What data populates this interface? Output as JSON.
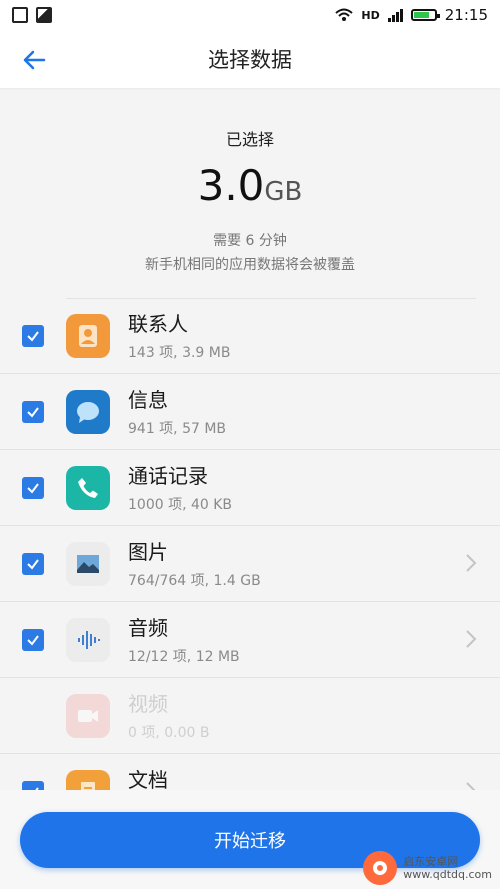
{
  "status_bar": {
    "time": "21:15",
    "network": "HD",
    "icons": [
      "notification-icon",
      "image-icon",
      "wifi-icon",
      "hd-icon",
      "signal-icon",
      "battery-icon"
    ]
  },
  "header": {
    "title": "选择数据",
    "back_icon": "arrow-left-icon"
  },
  "summary": {
    "label": "已选择",
    "size_value": "3.0",
    "size_unit": "GB",
    "time_text": "需要 6 分钟",
    "note": "新手机相同的应用数据将会被覆盖"
  },
  "items": [
    {
      "name": "联系人",
      "meta": "143 项, 3.9 MB",
      "checked": true,
      "icon": "contacts-icon",
      "color": "#f29a3b",
      "chevron": false
    },
    {
      "name": "信息",
      "meta": "941 项, 57 MB",
      "checked": true,
      "icon": "message-icon",
      "color": "#1f7ac9",
      "chevron": false
    },
    {
      "name": "通话记录",
      "meta": "1000 项, 40 KB",
      "checked": true,
      "icon": "phone-icon",
      "color": "#1bb6a5",
      "chevron": false
    },
    {
      "name": "图片",
      "meta": "764/764 项, 1.4 GB",
      "checked": true,
      "icon": "photo-icon",
      "color": "#ececec",
      "chevron": true
    },
    {
      "name": "音频",
      "meta": "12/12 项, 12 MB",
      "checked": true,
      "icon": "audio-icon",
      "color": "#ececec",
      "chevron": true
    },
    {
      "name": "视频",
      "meta": "0 项, 0.00 B",
      "checked": false,
      "icon": "video-icon",
      "color": "#f2a6a6",
      "chevron": false
    },
    {
      "name": "文档",
      "meta": "",
      "checked": true,
      "icon": "document-icon",
      "color": "#f2a03a",
      "chevron": true
    }
  ],
  "footer": {
    "start_label": "开始迁移"
  },
  "colors": {
    "accent": "#1e74e8",
    "checkbox": "#2c7be5"
  },
  "watermark": {
    "text_line1": "启东安卓网",
    "text_line2": "www.qdtdq.com"
  }
}
